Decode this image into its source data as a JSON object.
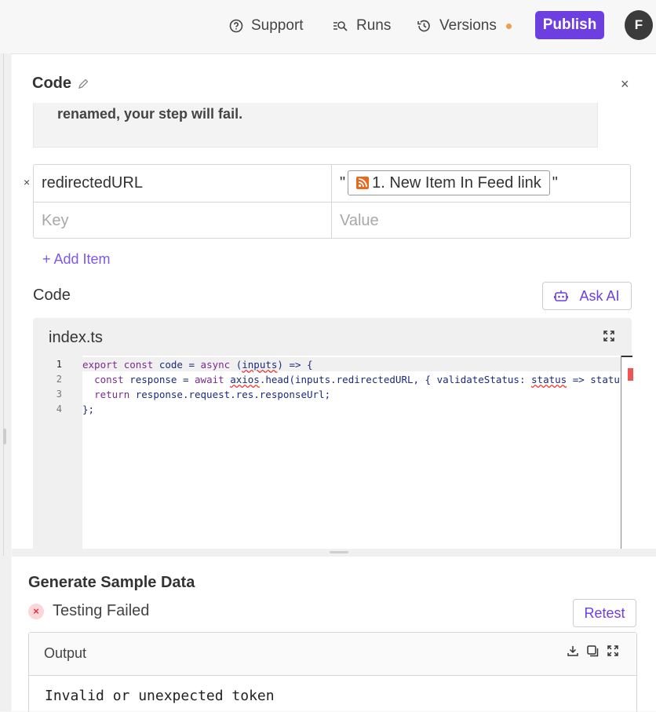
{
  "topbar": {
    "support": "Support",
    "runs": "Runs",
    "versions": "Versions",
    "publish": "Publish",
    "avatar": "F",
    "versions_dot_color": "#f39b4e",
    "accent": "#6e3fe0"
  },
  "panel": {
    "title": "Code",
    "close": "×",
    "description_tail": "renamed, your step will fail."
  },
  "inputs": {
    "rows": [
      {
        "key": "redirectedURL",
        "value_prefix": "\"",
        "pill_label": "1. New Item In Feed link",
        "value_suffix": "\""
      }
    ],
    "key_placeholder": "Key",
    "value_placeholder": "Value",
    "remove_icon": "×",
    "add_item": "+ Add Item"
  },
  "code": {
    "label": "Code",
    "ask_ai": "Ask AI",
    "file_name": "index.ts",
    "line_numbers": [
      "1",
      "2",
      "3",
      "4"
    ],
    "lines": [
      "export const code = async (inputs) => {",
      "  const response = await axios.head(inputs.redirectedURL, { validateStatus: status => statu",
      "  return response.request.res.responseUrl;",
      "};"
    ]
  },
  "sample": {
    "title": "Generate Sample Data",
    "status": "Testing Failed",
    "status_icon": "×",
    "retest": "Retest",
    "output_label": "Output",
    "output_text": "Invalid or unexpected token"
  }
}
